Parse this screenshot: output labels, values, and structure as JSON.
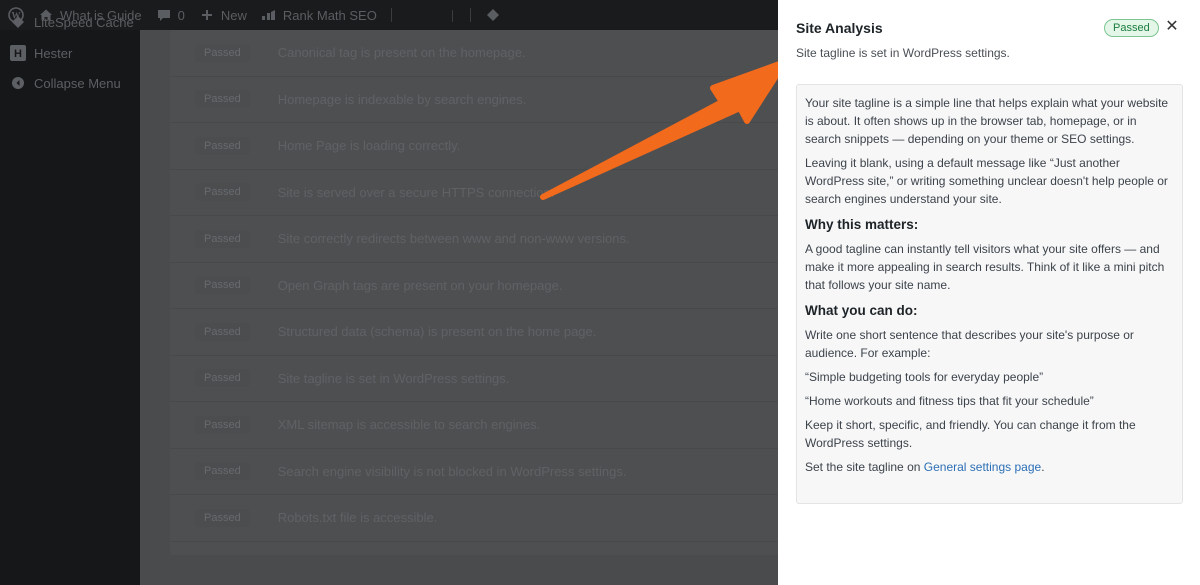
{
  "admin_bar": {
    "site_name": "What is Guide",
    "comments_count": "0",
    "new_label": "New",
    "rank_math_label": "Rank Math SEO"
  },
  "sidebar": {
    "items": [
      {
        "label": "LiteSpeed Cache",
        "icon": "diamond-icon"
      },
      {
        "label": "Hester",
        "icon": "hester-logo-icon"
      },
      {
        "label": "Collapse Menu",
        "icon": "collapse-icon"
      }
    ]
  },
  "checks": {
    "rows": [
      {
        "status": "Passed",
        "text": "Canonical tag is present on the homepage."
      },
      {
        "status": "Passed",
        "text": "Homepage is indexable by search engines."
      },
      {
        "status": "Passed",
        "text": "Home Page is loading correctly."
      },
      {
        "status": "Passed",
        "text": "Site is served over a secure HTTPS connection."
      },
      {
        "status": "Passed",
        "text": "Site correctly redirects between www and non-www versions."
      },
      {
        "status": "Passed",
        "text": "Open Graph tags are present on your homepage."
      },
      {
        "status": "Passed",
        "text": "Structured data (schema) is present on the home page."
      },
      {
        "status": "Passed",
        "text": "Site tagline is set in WordPress settings."
      },
      {
        "status": "Passed",
        "text": "XML sitemap is accessible to search engines."
      },
      {
        "status": "Passed",
        "text": "Search engine visibility is not blocked in WordPress settings."
      },
      {
        "status": "Passed",
        "text": "Robots.txt file is accessible."
      }
    ]
  },
  "panel": {
    "title": "Site Analysis",
    "status": "Passed",
    "close_symbol": "✕",
    "subtitle": "Site tagline is set in WordPress settings.",
    "intro_1": "Your site tagline is a simple line that helps explain what your website is about. It often shows up in the browser tab, homepage, or in search snippets — depending on your theme or SEO settings.",
    "intro_2": "Leaving it blank, using a default message like “Just another WordPress site,” or writing something unclear doesn't help people or search engines understand your site.",
    "why_heading": "Why this matters:",
    "why_text": "A good tagline can instantly tell visitors what your site offers — and make it more appealing in search results. Think of it like a mini pitch that follows your site name.",
    "what_heading": "What you can do:",
    "what_text": "Write one short sentence that describes your site's purpose or audience. For example:",
    "example_1": "“Simple budgeting tools for everyday people”",
    "example_2": "“Home workouts and fitness tips that fit your schedule”",
    "keep_short": "Keep it short, specific, and friendly. You can change it from the WordPress settings.",
    "set_prefix": "Set the site tagline on",
    "set_link": "General settings page",
    "set_suffix": "."
  },
  "colors": {
    "accent_arrow": "#f26a1b",
    "passed_green": "#1a7d3e",
    "link_blue": "#2c6fb5"
  }
}
